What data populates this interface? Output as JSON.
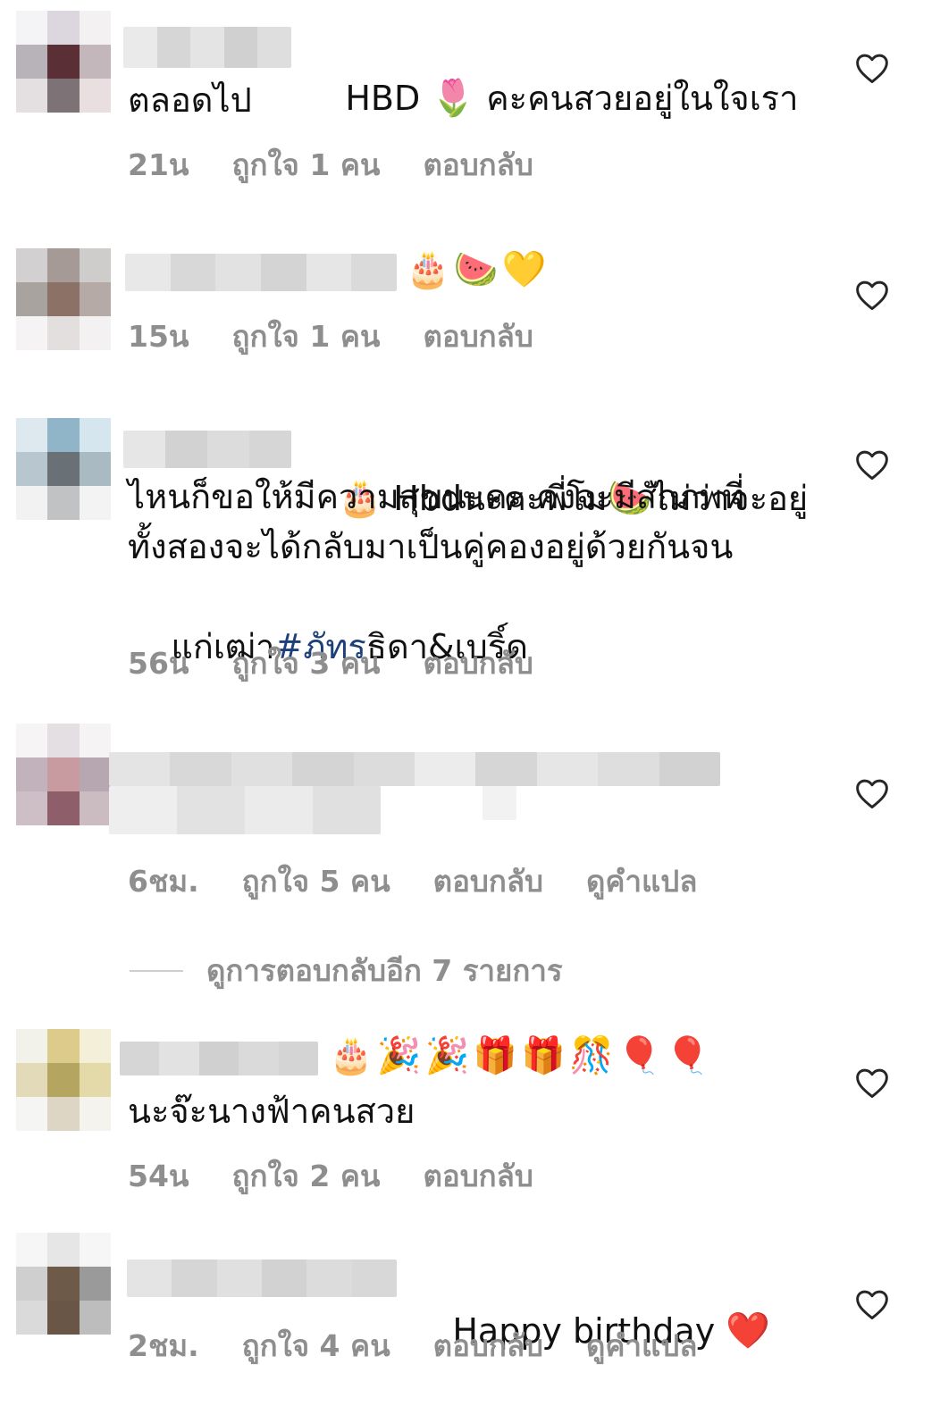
{
  "comments": [
    {
      "text_part1": "HBD",
      "emoji1": "🌷",
      "text_part2": "คะคนสวยอยู่ในใจเรา",
      "text_line2": "ตลอดไป",
      "time": "21น",
      "likes": "ถูกใจ 1 คน",
      "reply": "ตอบกลับ"
    },
    {
      "emojis": "🎂🍉💛",
      "time": "15น",
      "likes": "ถูกใจ 1 คน",
      "reply": "ตอบกลับ"
    },
    {
      "emoji_start": "🎂",
      "text_a": "Hbdนะคะพี่โม",
      "emoji_mid": "🍉",
      "text_b": "ไม่ว่าจะอยู่",
      "line2": "ไหนก็ขอให้มีความสุขนะคะ คงจะมีสักภพที่",
      "line3": "ทั้งสองจะได้กลับมาเป็นคู่คองอยู่ด้วยกันจน",
      "line4_pre": "แก่เฒ่า",
      "hashtag": "#ภัทร",
      "line4_post": "ธิดา&เบริ์ด",
      "time": "56น",
      "likes": "ถูกใจ 3 คน",
      "reply": "ตอบกลับ"
    },
    {
      "time": "6ชม.",
      "likes": "ถูกใจ 5 คน",
      "reply": "ตอบกลับ",
      "translate": "ดูคำแปล"
    },
    {
      "emojis": "🎂🎉🎉🎁🎁🎊🎈🎈",
      "text_line2": "นะจ๊ะนางฟ้าคนสวย",
      "time": "54น",
      "likes": "ถูกใจ 2 คน",
      "reply": "ตอบกลับ"
    },
    {
      "text": "Happy birthday",
      "emoji": "❤️",
      "time": "2ชม.",
      "likes": "ถูกใจ 4 คน",
      "reply": "ตอบกลับ",
      "translate": "ดูคำแปล"
    }
  ],
  "view_replies": "ดูการตอบกลับอีก 7 รายการ",
  "icons": {
    "like": "heart-outline-icon"
  },
  "colors": {
    "meta_text": "#8e8e8e",
    "hashtag": "#1d3f7a",
    "body_text": "#111111"
  }
}
